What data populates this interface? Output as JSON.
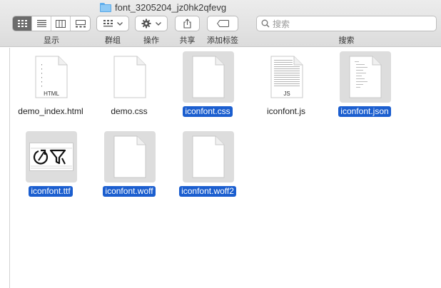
{
  "window": {
    "title": "font_3205204_jz0hk2qfevg"
  },
  "toolbar": {
    "view_label": "显示",
    "group_label": "群组",
    "action_label": "操作",
    "share_label": "共享",
    "tags_label": "添加标签",
    "search_label": "搜索",
    "search_placeholder": "搜索"
  },
  "files": [
    {
      "name": "demo_index.html",
      "ext": "HTML",
      "selected": false
    },
    {
      "name": "demo.css",
      "ext": "",
      "selected": false
    },
    {
      "name": "iconfont.css",
      "ext": "",
      "selected": true
    },
    {
      "name": "iconfont.js",
      "ext": "JS",
      "selected": false
    },
    {
      "name": "iconfont.json",
      "ext": "",
      "selected": true
    },
    {
      "name": "iconfont.ttf",
      "ext": "",
      "selected": true
    },
    {
      "name": "iconfont.woff",
      "ext": "",
      "selected": true
    },
    {
      "name": "iconfont.woff2",
      "ext": "",
      "selected": true
    }
  ],
  "colors": {
    "selection": "#1b5ecf",
    "toolbar": "#e3e3e3",
    "folder": "#8ec9f5"
  }
}
